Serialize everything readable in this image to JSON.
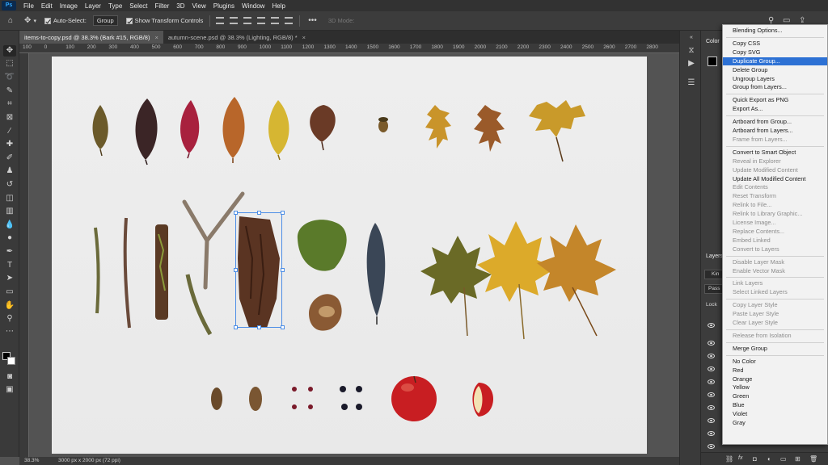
{
  "app": {
    "logo": "Ps"
  },
  "menubar": {
    "items": [
      "File",
      "Edit",
      "Image",
      "Layer",
      "Type",
      "Select",
      "Filter",
      "3D",
      "View",
      "Plugins",
      "Window",
      "Help"
    ]
  },
  "options": {
    "auto_select_label": "Auto-Select:",
    "auto_select_value": "Group",
    "show_transform_label": "Show Transform Controls",
    "mode_3d_label": "3D Mode:"
  },
  "tabs": [
    {
      "label": "items-to-copy.psd @ 38.3% (Bark #15, RGB/8)",
      "close": "×"
    },
    {
      "label": "autumn-scene.psd @ 38.3% (Lighting, RGB/8) *",
      "close": "×"
    }
  ],
  "ruler": {
    "top_labels": [
      "100",
      "0",
      "100",
      "200",
      "300",
      "400",
      "500",
      "600",
      "700",
      "800",
      "900",
      "1000",
      "1100",
      "1200",
      "1300",
      "1400",
      "1500",
      "1600",
      "1700",
      "1800",
      "1900",
      "2000",
      "2100",
      "2200",
      "2300",
      "2400",
      "2500",
      "2600",
      "2700",
      "2800"
    ]
  },
  "status": {
    "zoom": "38.3%",
    "doc_size": "3000 px x 2000 px (72 ppi)"
  },
  "panels": {
    "color_tab": "Color",
    "layers_tab": "Layers",
    "kind_label": "Kin",
    "pass_label": "Pass",
    "lock_label": "Lock"
  },
  "context_menu": {
    "items": [
      {
        "label": "Blending Options...",
        "state": "normal"
      },
      {
        "label": "---"
      },
      {
        "label": "Copy CSS",
        "state": "normal"
      },
      {
        "label": "Copy SVG",
        "state": "normal"
      },
      {
        "label": "Duplicate Group...",
        "state": "highlight"
      },
      {
        "label": "Delete Group",
        "state": "normal"
      },
      {
        "label": "Ungroup Layers",
        "state": "normal"
      },
      {
        "label": "Group from Layers...",
        "state": "normal"
      },
      {
        "label": "---"
      },
      {
        "label": "Quick Export as PNG",
        "state": "normal"
      },
      {
        "label": "Export As...",
        "state": "normal"
      },
      {
        "label": "---"
      },
      {
        "label": "Artboard from Group...",
        "state": "normal"
      },
      {
        "label": "Artboard from Layers...",
        "state": "normal"
      },
      {
        "label": "Frame from Layers...",
        "state": "disabled"
      },
      {
        "label": "---"
      },
      {
        "label": "Convert to Smart Object",
        "state": "normal"
      },
      {
        "label": "Reveal in Explorer",
        "state": "disabled"
      },
      {
        "label": "Update Modified Content",
        "state": "disabled"
      },
      {
        "label": "Update All Modified Content",
        "state": "normal"
      },
      {
        "label": "Edit Contents",
        "state": "disabled"
      },
      {
        "label": "Reset Transform",
        "state": "disabled"
      },
      {
        "label": "Relink to File...",
        "state": "disabled"
      },
      {
        "label": "Relink to Library Graphic...",
        "state": "disabled"
      },
      {
        "label": "License Image...",
        "state": "disabled"
      },
      {
        "label": "Replace Contents...",
        "state": "disabled"
      },
      {
        "label": "Embed Linked",
        "state": "disabled"
      },
      {
        "label": "Convert to Layers",
        "state": "disabled"
      },
      {
        "label": "---"
      },
      {
        "label": "Disable Layer Mask",
        "state": "disabled"
      },
      {
        "label": "Enable Vector Mask",
        "state": "disabled"
      },
      {
        "label": "---"
      },
      {
        "label": "Link Layers",
        "state": "disabled"
      },
      {
        "label": "Select Linked Layers",
        "state": "disabled"
      },
      {
        "label": "---"
      },
      {
        "label": "Copy Layer Style",
        "state": "disabled"
      },
      {
        "label": "Paste Layer Style",
        "state": "disabled"
      },
      {
        "label": "Clear Layer Style",
        "state": "disabled"
      },
      {
        "label": "---"
      },
      {
        "label": "Release from Isolation",
        "state": "disabled"
      },
      {
        "label": "---"
      },
      {
        "label": "Merge Group",
        "state": "normal"
      },
      {
        "label": "---"
      },
      {
        "label": "No Color",
        "state": "normal"
      },
      {
        "label": "Red",
        "state": "normal"
      },
      {
        "label": "Orange",
        "state": "normal"
      },
      {
        "label": "Yellow",
        "state": "normal"
      },
      {
        "label": "Green",
        "state": "normal"
      },
      {
        "label": "Blue",
        "state": "normal"
      },
      {
        "label": "Violet",
        "state": "normal"
      },
      {
        "label": "Gray",
        "state": "normal"
      }
    ]
  },
  "colors": {
    "highlight": "#2d71d4",
    "selection": "#4d8ee6"
  }
}
